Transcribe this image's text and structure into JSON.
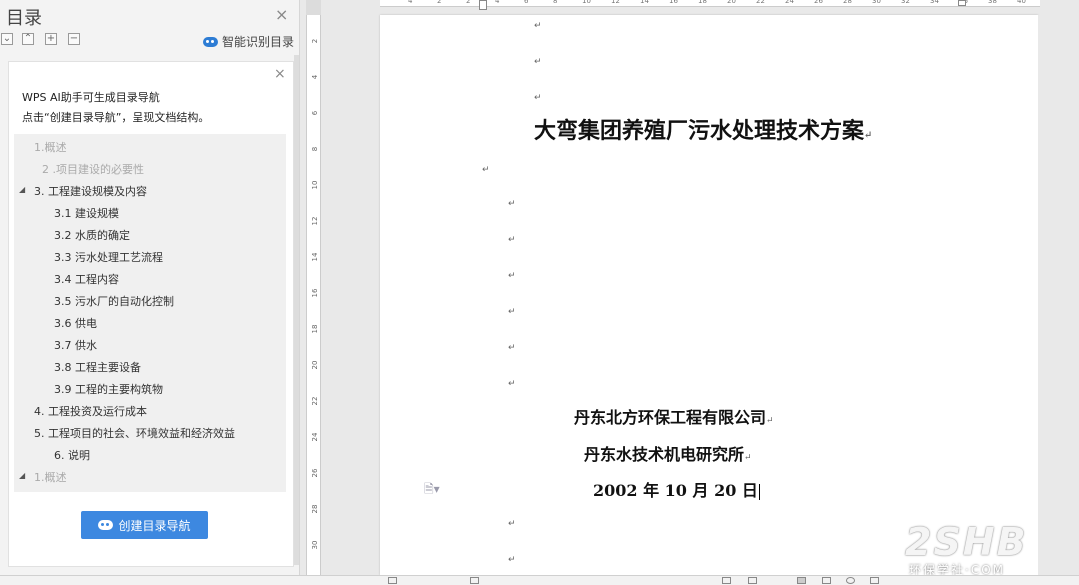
{
  "toc_panel": {
    "title": "目录",
    "close_glyph": "×",
    "toolbar": {
      "expand_glyph": "⌄",
      "collapse_glyph": "⌃",
      "plus_glyph": "+",
      "minus_glyph": "−",
      "smart_label": "智能识别目录"
    },
    "ai_card": {
      "close_glyph": "×",
      "line1": "WPS AI助手可生成目录导航",
      "line2": "点击“创建目录导航”，呈现文档结构。",
      "button_label": "创建目录导航"
    },
    "items": [
      {
        "label": "1.概述",
        "level": 1,
        "faded": true,
        "arrow": ""
      },
      {
        "label": "2 .项目建设的必要性",
        "level": 2,
        "faded": true,
        "arrow": ""
      },
      {
        "label": "3. 工程建设规模及内容",
        "level": 1,
        "faded": false,
        "arrow": "◢"
      },
      {
        "label": "3.1 建设规模",
        "level": 3,
        "faded": false,
        "arrow": ""
      },
      {
        "label": "3.2 水质的确定",
        "level": 3,
        "faded": false,
        "arrow": ""
      },
      {
        "label": "3.3 污水处理工艺流程",
        "level": 3,
        "faded": false,
        "arrow": ""
      },
      {
        "label": "3.4 工程内容",
        "level": 3,
        "faded": false,
        "arrow": ""
      },
      {
        "label": "3.5 污水厂的自动化控制",
        "level": 3,
        "faded": false,
        "arrow": ""
      },
      {
        "label": "3.6 供电",
        "level": 3,
        "faded": false,
        "arrow": ""
      },
      {
        "label": "3.7 供水",
        "level": 3,
        "faded": false,
        "arrow": ""
      },
      {
        "label": "3.8 工程主要设备",
        "level": 3,
        "faded": false,
        "arrow": ""
      },
      {
        "label": "3.9 工程的主要构筑物",
        "level": 3,
        "faded": false,
        "arrow": ""
      },
      {
        "label": "4. 工程投资及运行成本",
        "level": 1,
        "faded": false,
        "arrow": ""
      },
      {
        "label": "5. 工程项目的社会、环境效益和经济效益",
        "level": 1,
        "faded": false,
        "arrow": ""
      },
      {
        "label": "6. 说明",
        "level": 3,
        "faded": false,
        "arrow": ""
      },
      {
        "label": "1.概述",
        "level": 1,
        "faded": true,
        "arrow": "◢"
      }
    ]
  },
  "rulers": {
    "vertical_ticks": [
      "2",
      "4",
      "6",
      "8",
      "10",
      "12",
      "14",
      "16",
      "18",
      "20",
      "22",
      "24",
      "26",
      "28",
      "30"
    ],
    "horizontal_ticks": [
      "4",
      "2",
      "2",
      "4",
      "6",
      "8",
      "10",
      "12",
      "14",
      "16",
      "18",
      "20",
      "22",
      "24",
      "26",
      "28",
      "30",
      "32",
      "34",
      "36",
      "38",
      "40"
    ]
  },
  "document": {
    "paragraph_mark": "↵",
    "title": "大弯集团养殖厂污水处理技术方案",
    "org1": "丹东北方环保工程有限公司",
    "org2": "丹东水技术机电研究所",
    "date": "2002 年 10 月 20 日",
    "doc_icon": "🗎▾"
  },
  "watermark": {
    "logo": "2SHB",
    "sub": "环保学社·COM"
  }
}
